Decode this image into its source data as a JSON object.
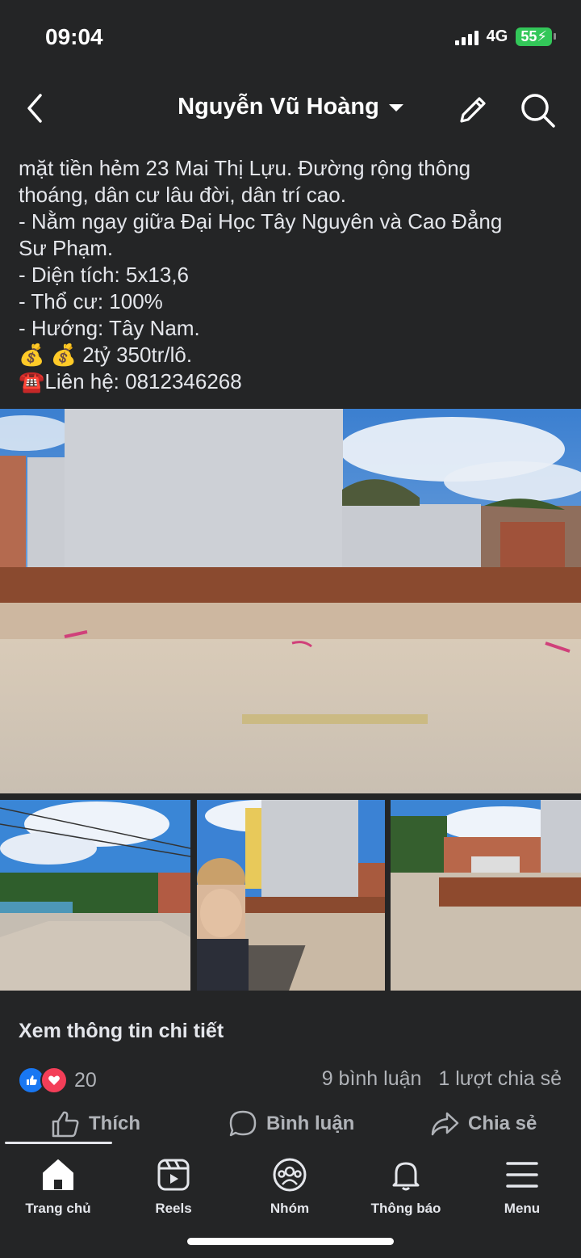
{
  "status": {
    "time": "09:04",
    "network": "4G",
    "battery": "55"
  },
  "header": {
    "title": "Nguyễn Vũ Hoàng"
  },
  "post": {
    "lines": [
      "mặt tiền hẻm 23 Mai Thị Lựu. Đường rộng thông",
      "thoáng, dân cư lâu đời, dân trí cao.",
      "- Nằm ngay giữa Đại Học Tây Nguyên và Cao Đẳng",
      "Sư Phạm.",
      "- Diện tích: 5x13,6",
      "- Thổ cư: 100%",
      "- Hướng: Tây Nam.",
      "💰 💰  2tỷ 350tr/lô.",
      "☎️Liên hệ: 0812346268"
    ],
    "see_more": "Xem thông tin chi tiết",
    "reaction_count": "20",
    "comments": "9 bình luận",
    "shares": "1 lượt chia sẻ"
  },
  "actions": {
    "like": "Thích",
    "comment": "Bình luận",
    "share": "Chia sẻ"
  },
  "tabbar": [
    {
      "label": "Trang chủ",
      "icon": "home-icon"
    },
    {
      "label": "Reels",
      "icon": "reels-icon"
    },
    {
      "label": "Nhóm",
      "icon": "groups-icon"
    },
    {
      "label": "Thông báo",
      "icon": "bell-icon"
    },
    {
      "label": "Menu",
      "icon": "menu-icon"
    }
  ],
  "colors": {
    "background": "#242526",
    "text": "#e4e6eb",
    "muted": "#b0b3b8",
    "like": "#1877f2",
    "love": "#f33e58",
    "battery": "#33c759"
  }
}
